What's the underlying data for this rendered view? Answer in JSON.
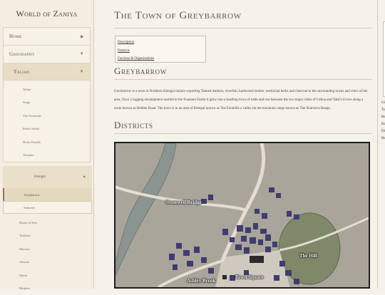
{
  "site_title": "World of Zaniya",
  "nav": {
    "home": "Home",
    "geography": "Geography",
    "region": "Talian",
    "region_items": [
      "Talian",
      "Seign",
      "The Freelands",
      "Relan Asbak",
      "Holm Durakk",
      "Alnamia"
    ],
    "klengal": "Klengal",
    "klengal_items": [
      "Greybarrow",
      "Solarede"
    ],
    "more_items": [
      "Dunes of Sret",
      "Tashirun",
      "Myrtera",
      "Alronia",
      "Ithron",
      "Hespher"
    ],
    "arrow_right": "▶",
    "arrow_down": "▼"
  },
  "page": {
    "title": "The Town of Greybarrow",
    "toc": [
      "Description",
      "Districts",
      "Factions & Organizations"
    ],
    "section1": "Greybarrow",
    "description": "Greybarrow is a town in Northern Klengal mainly exporting Tanned leathers, riverfish, hardwood lumber, medicinal herbs and charcoal to the surrounding towns and cities of the area. Once a logging encampment nestled in the Foamere Forest it grew into a bustling town of trade and rest between the two major cities of Lithua and Takil's Grove along a route known as Hobble Road. The town is in an area of Klengal known as The Foothills a valley im the mountain range known as The Shalverra Range.",
    "section2": "Districts"
  },
  "map": {
    "labels": [
      "Stonewell Bridge",
      "The Hill",
      "Town Square",
      "Ashley Brook"
    ]
  },
  "right_panel": {
    "lines": [
      "Gi",
      "Ty",
      "Re",
      "Ra",
      "Di",
      "Re"
    ]
  }
}
